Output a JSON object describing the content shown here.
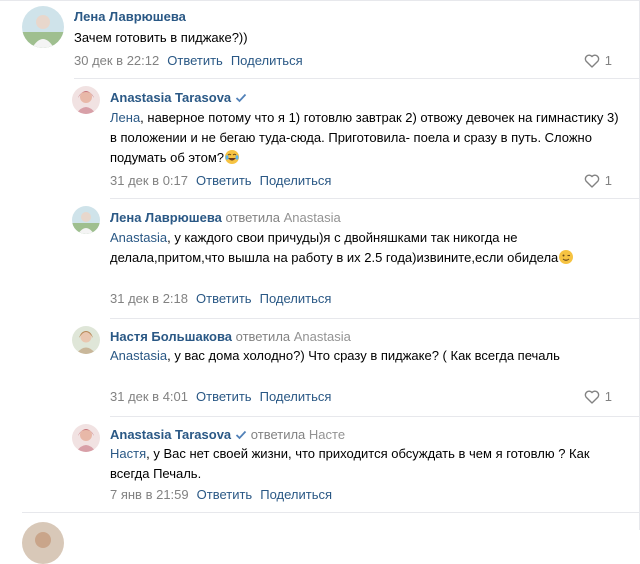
{
  "comments": [
    {
      "author": "Лена Лаврюшева",
      "text": "Зачем готовить в пиджаке?))",
      "date": "30 дек в 22:12",
      "reply_label": "Ответить",
      "share_label": "Поделиться",
      "likes": "1"
    },
    {
      "author": "Anastasia Tarasova",
      "addressee": "Лена",
      "text": ", наверное потому что я 1) готовлю завтрак 2) отвожу девочек на гимнастику 3) в положении и не бегаю туда-сюда. Приготовила- поела и сразу в путь. Сложно подумать об этом?",
      "date": "31 дек в 0:17",
      "reply_label": "Ответить",
      "share_label": "Поделиться",
      "likes": "1"
    },
    {
      "author": "Лена Лаврюшева",
      "replied_label": "ответила",
      "replied_to": "Anastasia",
      "addressee": "Anastasia",
      "text": ", у каждого свои причуды)я с двойняшками так никогда не делала,притом,что вышла на работу в их 2.5 года)извините,если обидела",
      "date": "31 дек в 2:18",
      "reply_label": "Ответить",
      "share_label": "Поделиться"
    },
    {
      "author": "Настя Большакова",
      "replied_label": "ответила",
      "replied_to": "Anastasia",
      "addressee": "Anastasia",
      "text": ", у вас дома холодно?) Что сразу в пиджаке? ( Как всегда печаль",
      "date": "31 дек в 4:01",
      "reply_label": "Ответить",
      "share_label": "Поделиться",
      "likes": "1"
    },
    {
      "author": "Anastasia Tarasova",
      "replied_label": "ответила",
      "replied_to": "Насте",
      "addressee": "Настя",
      "text": ", у Вас нет своей жизни, что приходится обсуждать в чем я готовлю ? Как всегда Печаль.",
      "date": "7 янв в 21:59",
      "reply_label": "Ответить",
      "share_label": "Поделиться"
    }
  ],
  "colors": {
    "link": "#2a5885",
    "meta": "#828282",
    "divider": "#e7e8ec"
  },
  "icons": {
    "like": "heart-outline-icon",
    "verified": "checkmark-icon",
    "laugh": "tears-of-joy-emoji",
    "wink": "winking-emoji"
  }
}
